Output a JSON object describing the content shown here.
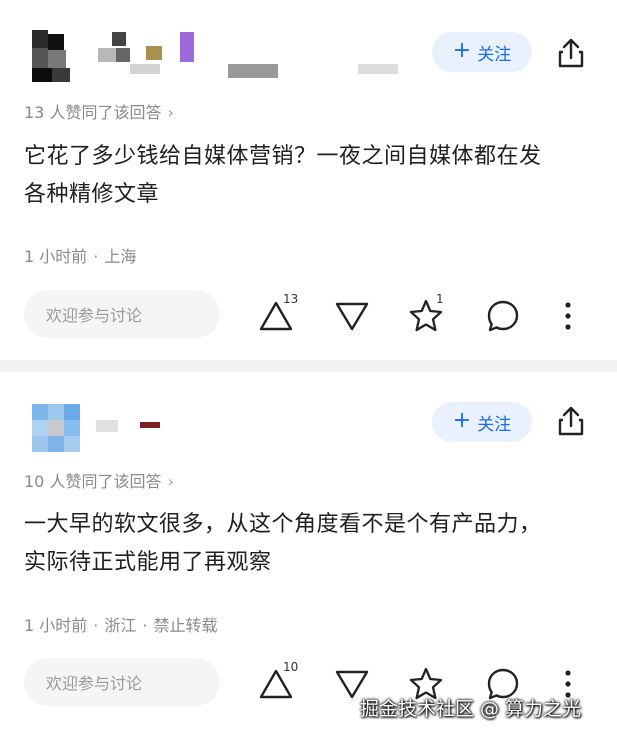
{
  "answers": [
    {
      "follow_label": "关注",
      "likes_text": "13 人赞同了该回答",
      "content_line1": "它花了多少钱给自媒体营销？一夜之间自媒体都在发",
      "content_line2": "各种精修文章",
      "meta_time": "1 小时前",
      "meta_location": "上海",
      "comment_placeholder": "欢迎参与讨论",
      "upvote_count": "13",
      "favorite_count": "1"
    },
    {
      "follow_label": "关注",
      "likes_text": "10 人赞同了该回答",
      "content_line1": "一大早的软文很多，从这个角度看不是个有产品力，",
      "content_line2": "实际待正式能用了再观察",
      "meta_time": "1 小时前",
      "meta_location": "浙江",
      "meta_extra": "禁止转载",
      "comment_placeholder": "欢迎参与讨论",
      "upvote_count": "10"
    }
  ],
  "watermark": "掘金技术社区 @ 算力之光",
  "colors": {
    "accent": "#1a6ce8",
    "follow_bg": "#e9f1fd",
    "muted": "#8a8a8a"
  }
}
